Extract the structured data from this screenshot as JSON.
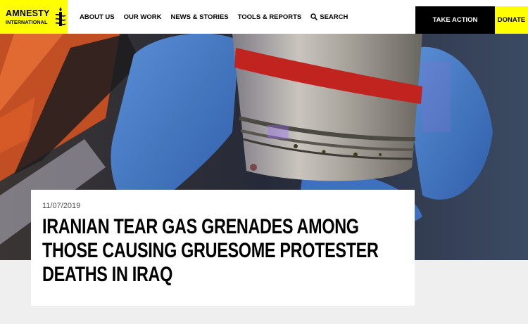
{
  "brand": {
    "line1": "AMNESTY",
    "line2": "INTERNATIONAL",
    "logo_icon": "candle-barbed-wire-icon",
    "accent": "#ffff00"
  },
  "nav": {
    "items": [
      "ABOUT US",
      "OUR WORK",
      "NEWS & STORIES",
      "TOOLS & REPORTS"
    ],
    "search_label": "SEARCH",
    "search_icon": "search-icon"
  },
  "cta": {
    "take_action": "TAKE ACTION",
    "donate": "DONATE"
  },
  "article": {
    "date": "11/07/2019",
    "headline": "IRANIAN TEAR GAS GRENADES AMONG THOSE CAUSING GRUESOME PROTESTER DEATHS IN IRAQ"
  }
}
